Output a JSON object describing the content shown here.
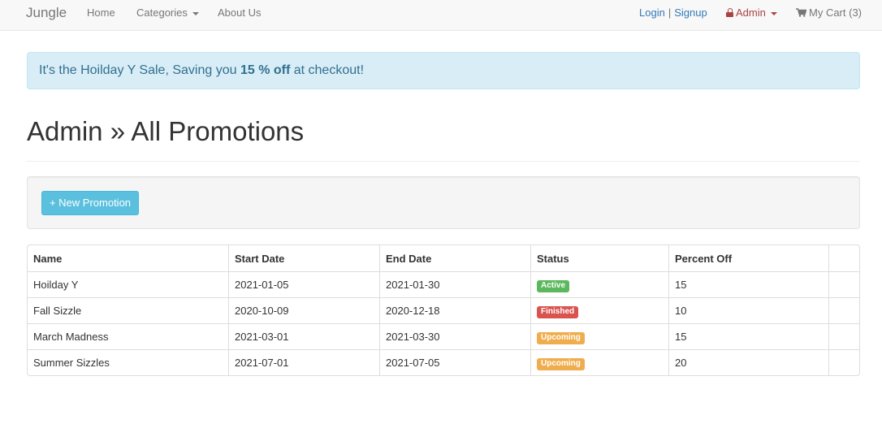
{
  "navbar": {
    "brand": "Jungle",
    "home": "Home",
    "categories": "Categories",
    "about": "About Us",
    "login": "Login",
    "separator": "|",
    "signup": "Signup",
    "admin": "Admin",
    "cart": "My Cart (3)"
  },
  "alert": {
    "prefix": "It's the Hoilday Y Sale, Saving you ",
    "highlight": "15 % off",
    "suffix": " at checkout!"
  },
  "page": {
    "title": "Admin » All Promotions",
    "new_button": "+ New Promotion"
  },
  "table": {
    "headers": [
      "Name",
      "Start Date",
      "End Date",
      "Status",
      "Percent Off",
      ""
    ],
    "rows": [
      {
        "name": "Hoilday Y",
        "start": "2021-01-05",
        "end": "2021-01-30",
        "status": "Active",
        "percent": "15"
      },
      {
        "name": "Fall Sizzle",
        "start": "2020-10-09",
        "end": "2020-12-18",
        "status": "Finished",
        "percent": "10"
      },
      {
        "name": "March Madness",
        "start": "2021-03-01",
        "end": "2021-03-30",
        "status": "Upcoming",
        "percent": "15"
      },
      {
        "name": "Summer Sizzles",
        "start": "2021-07-01",
        "end": "2021-07-05",
        "status": "Upcoming",
        "percent": "20"
      }
    ]
  },
  "colors": {
    "active": "#5cb85c",
    "finished": "#d9534f",
    "upcoming": "#f0ad4e",
    "link": "#337ab7",
    "admin": "#a94442",
    "info_button": "#5bc0de"
  },
  "icons": {
    "admin": "lock-icon",
    "cart": "shopping-cart-icon",
    "dropdown": "caret-down-icon"
  }
}
